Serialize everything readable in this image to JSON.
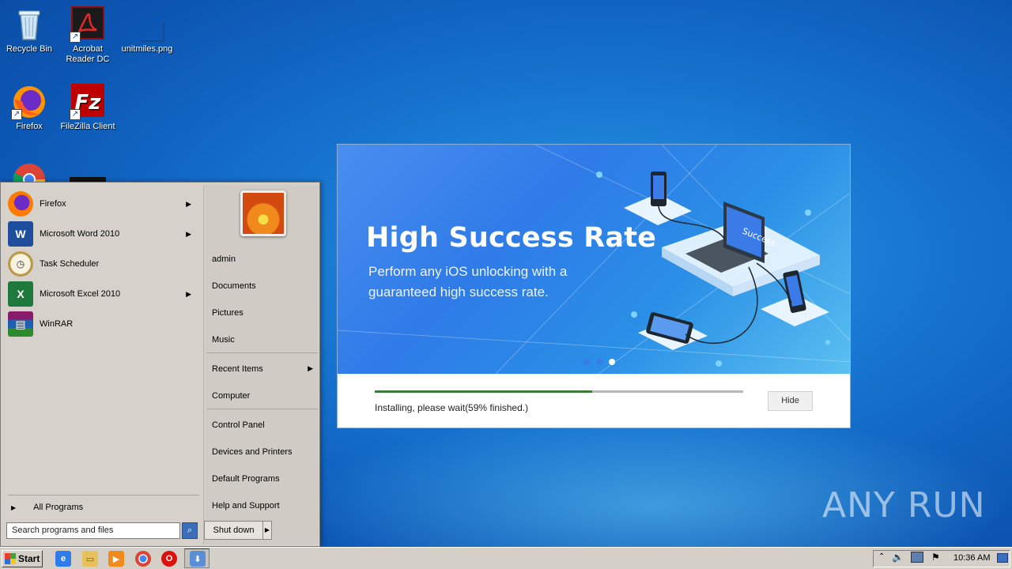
{
  "desktop": {
    "icons": [
      {
        "label": "Recycle Bin",
        "icon": "recycle-bin-icon"
      },
      {
        "label": "Acrobat Reader DC",
        "icon": "acrobat-icon"
      },
      {
        "label": "unitmiles.png",
        "icon": "image-file-icon"
      },
      {
        "label": "Firefox",
        "icon": "firefox-icon"
      },
      {
        "label": "FileZilla Client",
        "icon": "filezilla-icon"
      },
      {
        "label": "",
        "icon": "chrome-icon"
      }
    ]
  },
  "start_menu": {
    "programs": [
      {
        "label": "Firefox",
        "icon": "firefox-icon",
        "has_submenu": true
      },
      {
        "label": "Microsoft Word 2010",
        "icon": "word-icon",
        "has_submenu": true
      },
      {
        "label": "Task Scheduler",
        "icon": "clock-icon",
        "has_submenu": false
      },
      {
        "label": "Microsoft Excel 2010",
        "icon": "excel-icon",
        "has_submenu": true
      },
      {
        "label": "WinRAR",
        "icon": "winrar-icon",
        "has_submenu": false
      }
    ],
    "all_programs": "All Programs",
    "search_placeholder": "Search programs and files",
    "shutdown_label": "Shut down",
    "right_items": [
      "admin",
      "Documents",
      "Pictures",
      "Music",
      "Recent Items",
      "Computer",
      "Control Panel",
      "Devices and Printers",
      "Default Programs",
      "Help and Support"
    ]
  },
  "installer": {
    "title": "High Success Rate",
    "subtitle": "Perform any iOS unlocking with a guaranteed high success rate.",
    "illustration_label": "Success",
    "progress_fraction": 0.59,
    "status": "Installing, please wait(59% finished.)",
    "hide_label": "Hide",
    "carousel_active_index": 2
  },
  "watermark": "ANY RUN",
  "taskbar": {
    "start_label": "Start",
    "clock": "10:36 AM",
    "colors": {
      "taskbar_bg": "#d4d0c8",
      "accent": "#2f7be8"
    }
  }
}
